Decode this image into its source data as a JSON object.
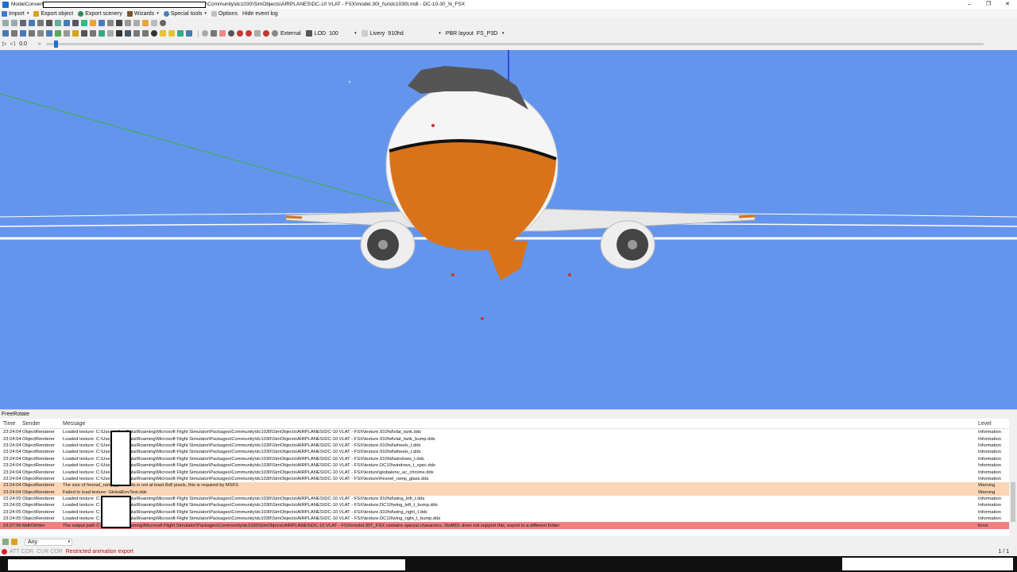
{
  "window": {
    "title_prefix": "ModelConvert",
    "title_suffix": "\\Community\\dc1030\\SimObjects\\AIRPLANES\\DC-10 VLAT - FSX\\model.30t_fsx\\dc1030t.mdl - DC-10-30_N_FSX",
    "minimize": "–",
    "maximize": "❐",
    "close": "✕"
  },
  "menu": {
    "import": "Import",
    "export_object": "Export object",
    "export_scenery": "Export scenery",
    "wizards": "Wizards",
    "special_tools": "Special tools",
    "options": "Options",
    "hide_event_log": "Hide event log"
  },
  "toolbar": {
    "camera": "External",
    "lod_label": "LOD",
    "lod_value": "100",
    "livery_label": "Livery",
    "livery_value": "910hd",
    "pbr_label": "PBR layout",
    "pbr_value": "FS_P3D",
    "anim_value": "0.0"
  },
  "panel": {
    "title": "FreeRotate"
  },
  "log": {
    "headers": {
      "time": "Time",
      "sender": "Sender",
      "message": "Message",
      "level": "Level"
    },
    "rows": [
      {
        "time": "23:24:04",
        "sender": "ObjectRenderer",
        "message": "Loaded texture: C:\\Users\\                 \\AppData\\Roaming\\Microsoft Flight Simulator\\Packages\\Community\\dc1030\\SimObjects\\AIRPLANES\\DC-10 VLAT - FSX\\texture.910hd\\vlat_tank.dds",
        "level": "Information",
        "kind": "info"
      },
      {
        "time": "23:24:04",
        "sender": "ObjectRenderer",
        "message": "Loaded texture: C:\\Users\\                 \\AppData\\Roaming\\Microsoft Flight Simulator\\Packages\\Community\\dc1030\\SimObjects\\AIRPLANES\\DC-10 VLAT - FSX\\texture.910hd\\vlat_tank_bump.dds",
        "level": "Information",
        "kind": "info"
      },
      {
        "time": "23:24:04",
        "sender": "ObjectRenderer",
        "message": "Loaded texture: C:\\Users\\                 \\AppData\\Roaming\\Microsoft Flight Simulator\\Packages\\Community\\dc1030\\SimObjects\\AIRPLANES\\DC-10 VLAT - FSX\\texture.910hd\\wheels_t.dds",
        "level": "Information",
        "kind": "info"
      },
      {
        "time": "23:24:04",
        "sender": "ObjectRenderer",
        "message": "Loaded texture: C:\\Users\\                 \\AppData\\Roaming\\Microsoft Flight Simulator\\Packages\\Community\\dc1030\\SimObjects\\AIRPLANES\\DC-10 VLAT - FSX\\texture.910hd\\wheels_t.dds",
        "level": "Information",
        "kind": "info"
      },
      {
        "time": "23:24:04",
        "sender": "ObjectRenderer",
        "message": "Loaded texture: C:\\Users\\                 \\AppData\\Roaming\\Microsoft Flight Simulator\\Packages\\Community\\dc1030\\SimObjects\\AIRPLANES\\DC-10 VLAT - FSX\\texture.910hd\\windows_t.dds",
        "level": "Information",
        "kind": "info"
      },
      {
        "time": "23:24:04",
        "sender": "ObjectRenderer",
        "message": "Loaded texture: C:\\Users\\                 \\AppData\\Roaming\\Microsoft Flight Simulator\\Packages\\Community\\dc1030\\SimObjects\\AIRPLANES\\DC-10 VLAT - FSX\\texture.DC10\\windows_t_spec.dds",
        "level": "Information",
        "kind": "info"
      },
      {
        "time": "23:24:04",
        "sender": "ObjectRenderer",
        "message": "Loaded texture: C:\\Users\\                 \\AppData\\Roaming\\Microsoft Flight Simulator\\Packages\\Community\\dc1030\\SimObjects\\AIRPLANES\\DC-10 VLAT - FSX\\texture\\globalenv_ac_chrome.dds",
        "level": "Information",
        "kind": "info"
      },
      {
        "time": "23:24:04",
        "sender": "ObjectRenderer",
        "message": "Loaded texture: C:\\Users\\                 \\AppData\\Roaming\\Microsoft Flight Simulator\\Packages\\Community\\dc1030\\SimObjects\\AIRPLANES\\DC-10 VLAT - FSX\\texture\\fresnel_ramp_glass.dds",
        "level": "Information",
        "kind": "info"
      },
      {
        "time": "23:24:04",
        "sender": "ObjectRenderer",
        "message": "The size of fresnel_ramp_glass.dds is not at least 8x8 pixels, this is required by MSFS",
        "level": "Warning",
        "kind": "warning"
      },
      {
        "time": "23:24:04",
        "sender": "ObjectRenderer",
        "message": "Failed to load texture: GlobalEnvTest.dds",
        "level": "Warning",
        "kind": "warning"
      },
      {
        "time": "23:24:05",
        "sender": "ObjectRenderer",
        "message": "Loaded texture: C:\\Users\\                 \\AppData\\Roaming\\Microsoft Flight Simulator\\Packages\\Community\\dc1030\\SimObjects\\AIRPLANES\\DC-10 VLAT - FSX\\texture.910hd\\wing_left_t.dds",
        "level": "Information",
        "kind": "info"
      },
      {
        "time": "23:24:05",
        "sender": "ObjectRenderer",
        "message": "Loaded texture: C:\\Users\\                 \\AppData\\Roaming\\Microsoft Flight Simulator\\Packages\\Community\\dc1030\\SimObjects\\AIRPLANES\\DC-10 VLAT - FSX\\texture.DC10\\wing_left_t_bump.dds",
        "level": "Information",
        "kind": "info"
      },
      {
        "time": "23:24:05",
        "sender": "ObjectRenderer",
        "message": "Loaded texture: C:\\Users\\                 \\AppData\\Roaming\\Microsoft Flight Simulator\\Packages\\Community\\dc1030\\SimObjects\\AIRPLANES\\DC-10 VLAT - FSX\\texture.910hd\\wing_right_t.dds",
        "level": "Information",
        "kind": "info"
      },
      {
        "time": "23:24:05",
        "sender": "ObjectRenderer",
        "message": "Loaded texture: C:\\Users\\                 \\AppData\\Roaming\\Microsoft Flight Simulator\\Packages\\Community\\dc1030\\SimObjects\\AIRPLANES\\DC-10 VLAT - FSX\\texture.DC10\\wing_right_t_bump.dds",
        "level": "Information",
        "kind": "info"
      },
      {
        "time": "23:27:06",
        "sender": "MdlXWriter",
        "message": "The output path C:\\                 \\AppData\\Roaming\\Microsoft Flight Simulator\\Packages\\Community\\dc1030\\SimObjects\\AIRPLANES\\DC-10 VLAT - FSX\\model.30T_FSX contains special characters. XtoMDL does not support this, export to a different folder",
        "level": "Error",
        "kind": "error"
      }
    ]
  },
  "filter": {
    "value": "Any"
  },
  "status": {
    "att": "ATT COR",
    "cur": "CUR COR",
    "message": "Restricted animation export",
    "page": "1 / 1"
  },
  "colors": {
    "sky": "#6495ed",
    "fuselage": "#f5f5f5",
    "orange": "#d9731a",
    "warning_row": "#fcd5b4",
    "error_row": "#f08080"
  }
}
